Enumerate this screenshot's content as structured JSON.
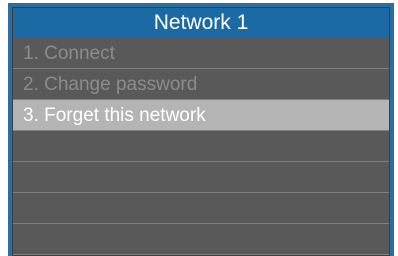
{
  "colors": {
    "frame": "#2a6fa3",
    "title_bar": "#1c6aa4",
    "panel": "#595959",
    "selected_row": "#b4b4b4",
    "text_dim": "#8c8c8c",
    "text_white": "#ffffff"
  },
  "title": "Network 1",
  "menu": {
    "items": [
      {
        "label": "1. Connect",
        "selected": false
      },
      {
        "label": "2. Change password",
        "selected": false
      },
      {
        "label": "3. Forget this network",
        "selected": true
      },
      {
        "label": "",
        "selected": false
      },
      {
        "label": "",
        "selected": false
      },
      {
        "label": "",
        "selected": false
      },
      {
        "label": "",
        "selected": false
      }
    ]
  }
}
